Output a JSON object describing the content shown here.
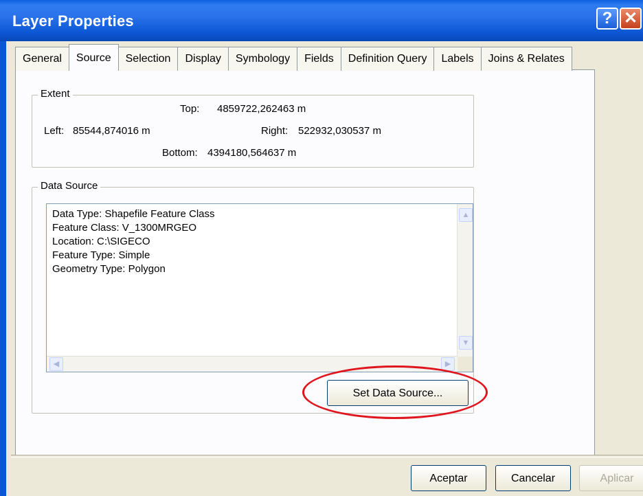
{
  "window": {
    "title": "Layer Properties",
    "help_glyph": "?",
    "close_glyph": "✕"
  },
  "tabs": [
    {
      "label": "General"
    },
    {
      "label": "Source",
      "active": true
    },
    {
      "label": "Selection"
    },
    {
      "label": "Display"
    },
    {
      "label": "Symbology"
    },
    {
      "label": "Fields"
    },
    {
      "label": "Definition Query"
    },
    {
      "label": "Labels"
    },
    {
      "label": "Joins & Relates"
    }
  ],
  "extent": {
    "label": "Extent",
    "top_label": "Top:",
    "top_value": "4859722,262463 m",
    "left_label": "Left:",
    "left_value": "85544,874016 m",
    "right_label": "Right:",
    "right_value": "522932,030537 m",
    "bottom_label": "Bottom:",
    "bottom_value": "4394180,564637 m"
  },
  "data_source": {
    "label": "Data Source",
    "lines": [
      "Data Type: Shapefile Feature Class",
      "Feature Class: V_1300MRGEO",
      "Location: C:\\SIGECO",
      "Feature Type: Simple",
      "Geometry Type: Polygon"
    ],
    "set_button": "Set Data Source..."
  },
  "buttons": {
    "ok": "Aceptar",
    "cancel": "Cancelar",
    "apply": "Aplicar"
  },
  "colors": {
    "titlebar": "#0b56d4",
    "highlight": "#e0161f"
  }
}
